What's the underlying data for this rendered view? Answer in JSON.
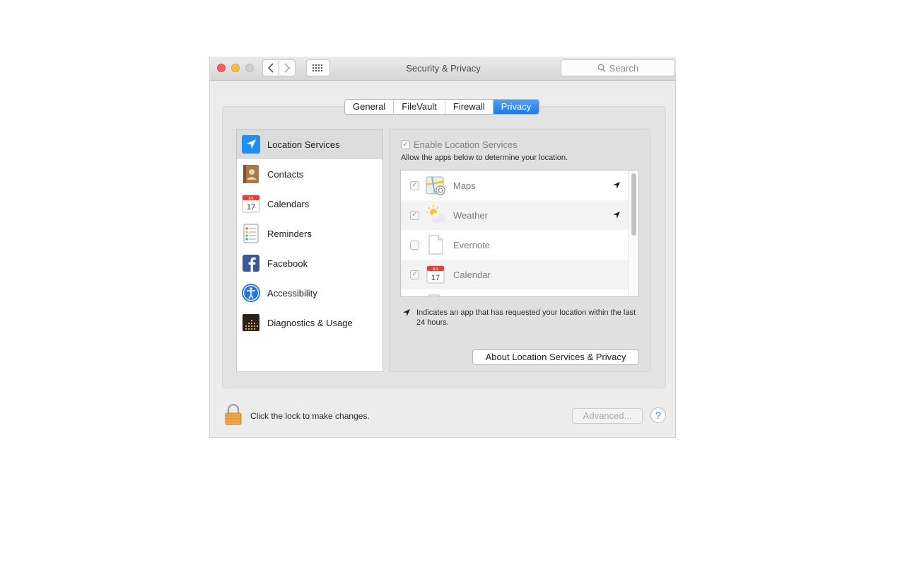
{
  "window": {
    "title": "Security & Privacy",
    "search_placeholder": "Search"
  },
  "tabs": [
    {
      "label": "General",
      "active": false
    },
    {
      "label": "FileVault",
      "active": false
    },
    {
      "label": "Firewall",
      "active": false
    },
    {
      "label": "Privacy",
      "active": true
    }
  ],
  "sidebar": {
    "items": [
      {
        "label": "Location Services",
        "icon": "location-arrow-icon",
        "selected": true
      },
      {
        "label": "Contacts",
        "icon": "contacts-book-icon",
        "selected": false
      },
      {
        "label": "Calendars",
        "icon": "calendar-icon",
        "selected": false
      },
      {
        "label": "Reminders",
        "icon": "reminders-list-icon",
        "selected": false
      },
      {
        "label": "Facebook",
        "icon": "facebook-icon",
        "selected": false
      },
      {
        "label": "Accessibility",
        "icon": "accessibility-icon",
        "selected": false
      },
      {
        "label": "Diagnostics & Usage",
        "icon": "diagnostics-icon",
        "selected": false
      }
    ]
  },
  "location": {
    "enable_label": "Enable Location Services",
    "enable_checked": true,
    "allow_text": "Allow the apps below to determine your location.",
    "apps": [
      {
        "name": "Maps",
        "checked": true,
        "recent": true,
        "icon": "maps-icon"
      },
      {
        "name": "Weather",
        "checked": true,
        "recent": true,
        "icon": "weather-icon"
      },
      {
        "name": "Evernote",
        "checked": false,
        "recent": false,
        "icon": "document-icon"
      },
      {
        "name": "Calendar",
        "checked": true,
        "recent": false,
        "icon": "calendar-icon"
      }
    ],
    "legend_text": "Indicates an app that has requested your location within the last 24 hours.",
    "about_button": "About Location Services & Privacy"
  },
  "calendar_icon": {
    "month": "JUL",
    "day": "17"
  },
  "footer": {
    "lock_text": "Click the lock to make changes.",
    "advanced_button": "Advanced...",
    "help_button": "?"
  },
  "colors": {
    "accent": "#1a7cf0",
    "close": "#fc605c",
    "minimize": "#fdbc40"
  }
}
